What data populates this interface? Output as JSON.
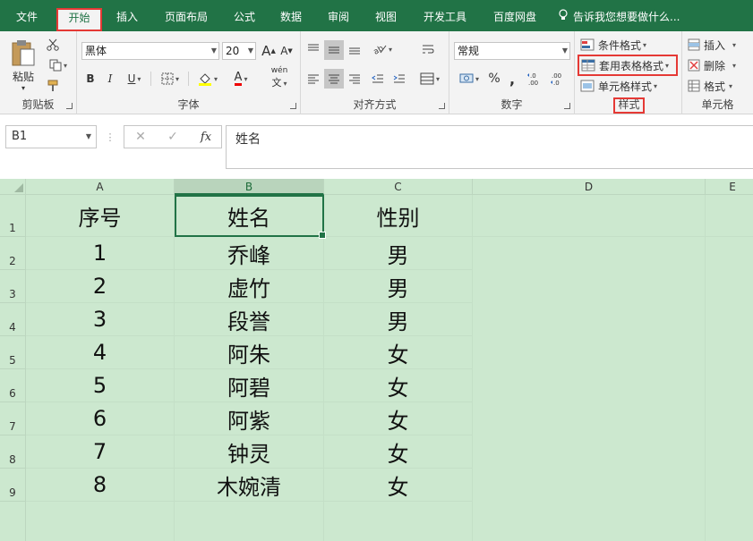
{
  "tabs": [
    "文件",
    "开始",
    "插入",
    "页面布局",
    "公式",
    "数据",
    "审阅",
    "视图",
    "开发工具",
    "百度网盘"
  ],
  "active_tab": "开始",
  "tell_me": "告诉我您想要做什么...",
  "clipboard": {
    "paste": "粘贴",
    "label": "剪贴板"
  },
  "font": {
    "name": "黑体",
    "size": "20",
    "grow": "A",
    "shrink": "A",
    "bold": "B",
    "italic": "I",
    "underline": "U",
    "color_a": "A",
    "phonetic": "wén",
    "label": "字体"
  },
  "alignment": {
    "label": "对齐方式"
  },
  "number": {
    "format": "常规",
    "percent": "%",
    "comma": ",",
    "label": "数字"
  },
  "styles": {
    "conditional": "条件格式",
    "table": "套用表格格式",
    "cell": "单元格样式",
    "label": "样式"
  },
  "cells": {
    "insert": "插入",
    "delete": "删除",
    "format": "格式",
    "label": "单元格"
  },
  "formula_bar": {
    "name_box": "B1",
    "fx": "fx",
    "content": "姓名"
  },
  "columns": [
    "A",
    "B",
    "C",
    "D",
    "E"
  ],
  "rows": [
    "1",
    "2",
    "3",
    "4",
    "5",
    "6",
    "7",
    "8",
    "9"
  ],
  "table": {
    "header": [
      "序号",
      "姓名",
      "性别"
    ],
    "rows": [
      [
        "1",
        "乔峰",
        "男"
      ],
      [
        "2",
        "虚竹",
        "男"
      ],
      [
        "3",
        "段誉",
        "男"
      ],
      [
        "4",
        "阿朱",
        "女"
      ],
      [
        "5",
        "阿碧",
        "女"
      ],
      [
        "6",
        "阿紫",
        "女"
      ],
      [
        "7",
        "钟灵",
        "女"
      ],
      [
        "8",
        "木婉清",
        "女"
      ]
    ]
  },
  "colors": {
    "ribbon_green": "#217346",
    "sheet_bg": "#cce8cf",
    "highlight": "#e53935"
  }
}
